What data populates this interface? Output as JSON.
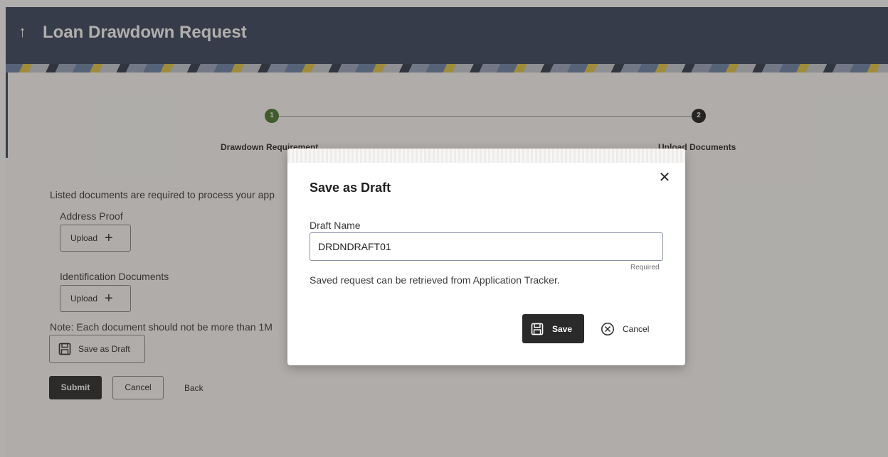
{
  "header": {
    "back_icon": "↑",
    "title": "Loan Drawdown Request"
  },
  "stepper": {
    "steps": [
      {
        "number": "1",
        "label": "Drawdown Requirement",
        "status": "completed",
        "color": "#4b7a2f"
      },
      {
        "number": "2",
        "label": "Upload Documents",
        "status": "current",
        "color": "#1f1f1f"
      }
    ]
  },
  "form": {
    "intro_text": "Listed documents are required to process your app",
    "documents": [
      {
        "label": "Address Proof",
        "upload_label": "Upload"
      },
      {
        "label": "Identification Documents",
        "upload_label": "Upload"
      }
    ],
    "note_text": "Note: Each document should not be more than 1M",
    "save_draft_label": "Save as Draft",
    "submit_label": "Submit",
    "cancel_label": "Cancel",
    "back_label": "Back"
  },
  "modal": {
    "title": "Save as Draft",
    "close_icon": "✕",
    "field_label": "Draft Name",
    "field_value": "DRDNDRAFT01",
    "required_text": "Required",
    "hint_text": "Saved request can be retrieved from Application Tracker.",
    "save_label": "Save",
    "cancel_label": "Cancel"
  },
  "colors": {
    "header_bg": "#3a4660",
    "primary_button": "#2a2a2a",
    "step_completed": "#4b7a2f"
  },
  "icons": {
    "save": "floppy-disk-icon",
    "cancel": "circle-x-icon",
    "close": "close-icon",
    "plus": "plus-icon"
  }
}
